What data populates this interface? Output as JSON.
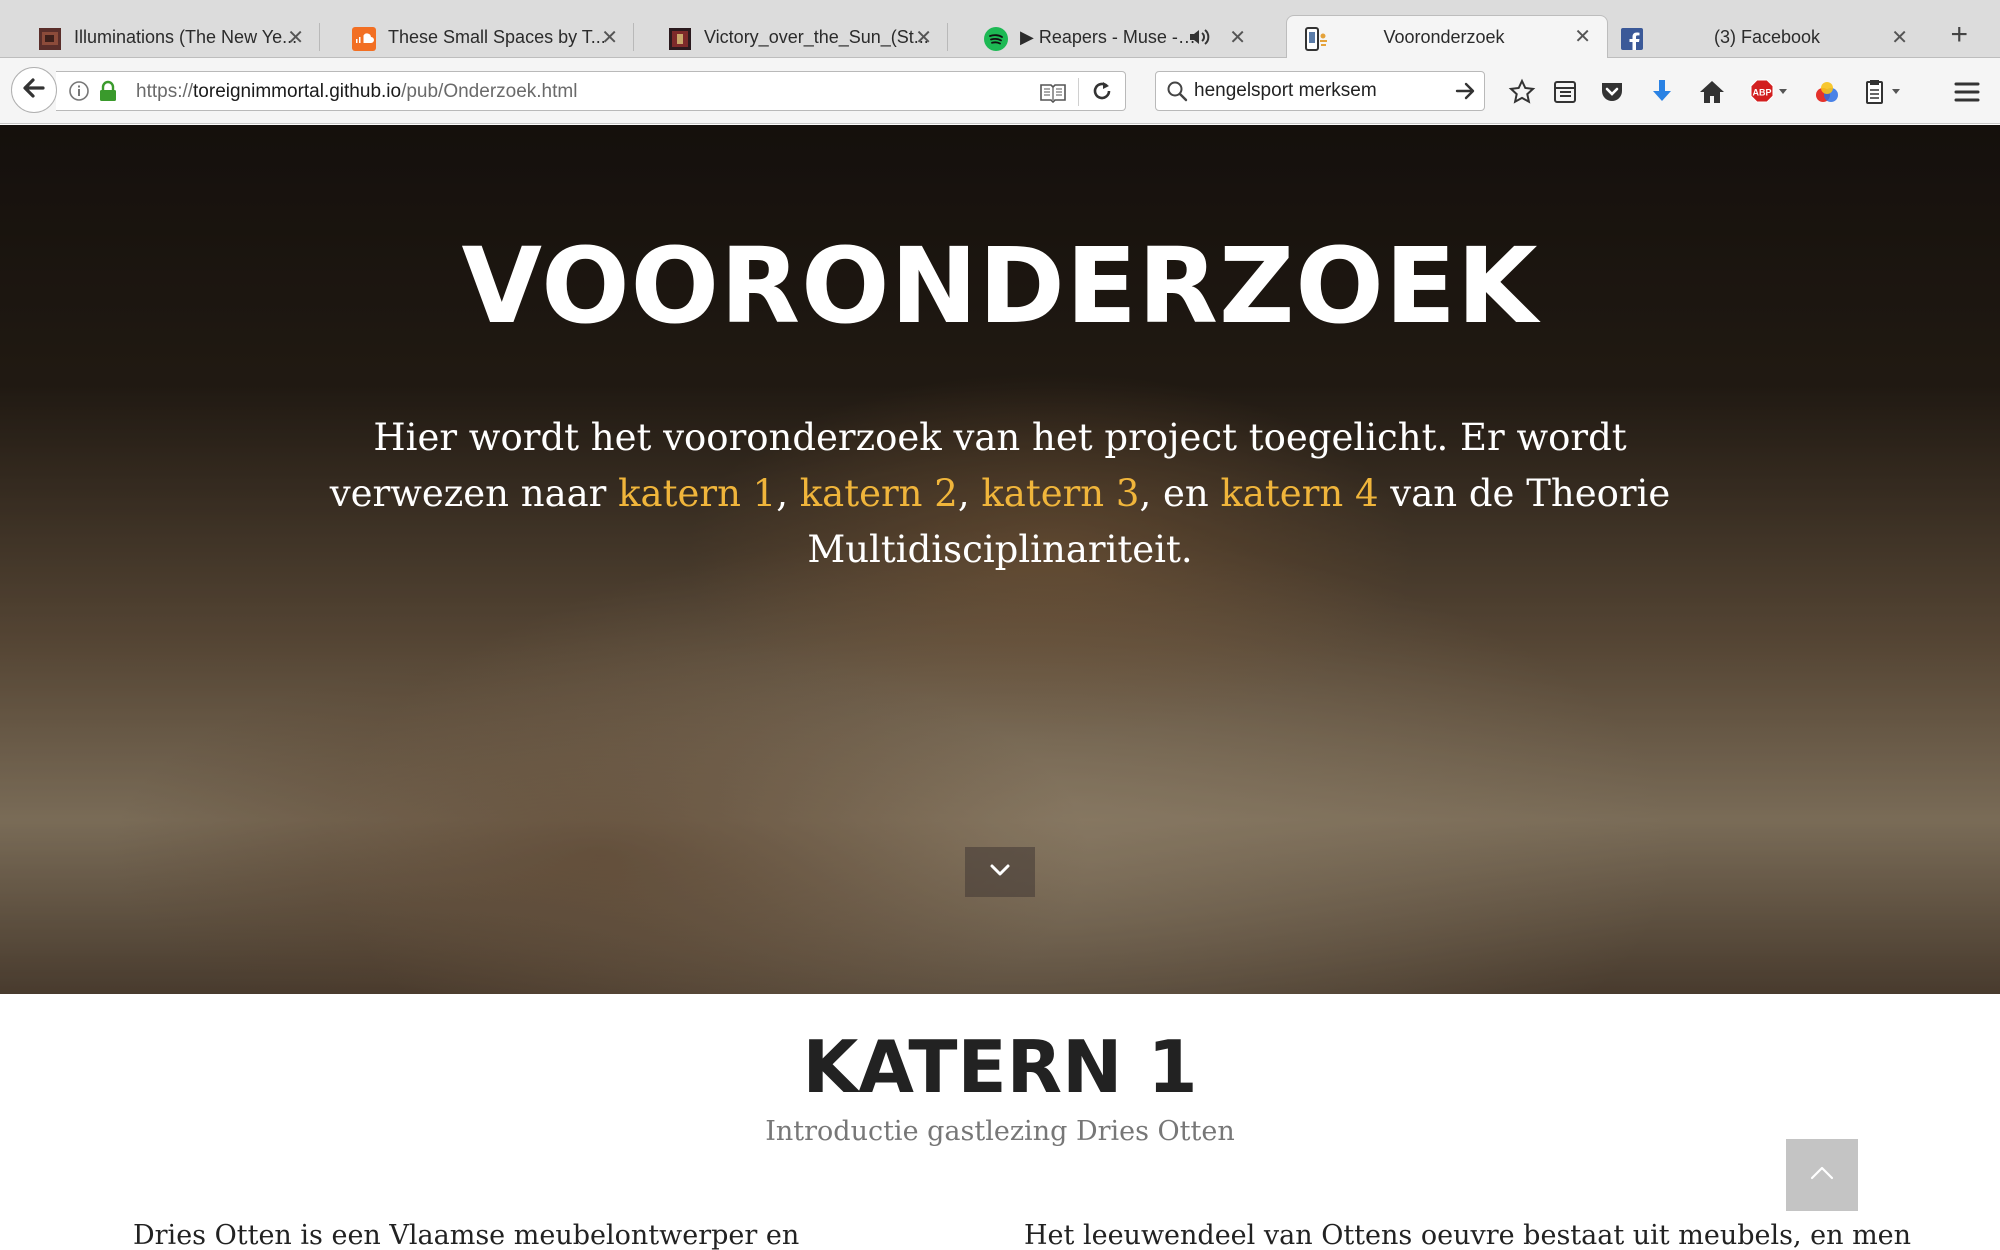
{
  "browser": {
    "tabs": [
      {
        "label": "Illuminations (The New Ye...",
        "icon": "artwork-favicon-icon",
        "active": false
      },
      {
        "label": "These Small Spaces by T...",
        "icon": "soundcloud-icon",
        "active": false
      },
      {
        "label": "Victory_over_the_Sun_(St...",
        "icon": "artwork-favicon-icon",
        "active": false
      },
      {
        "label": "▶ Reapers - Muse - S...",
        "icon": "spotify-icon",
        "active": false,
        "audio": true
      },
      {
        "label": "Vooronderzoek",
        "icon": "site-favicon-icon",
        "active": true
      },
      {
        "label": "(3) Facebook",
        "icon": "facebook-icon",
        "active": false
      }
    ],
    "new_tab_label": "+",
    "close_glyph": "✕",
    "url_prefix": "https://",
    "url_host": "toreignimmortal.github.io",
    "url_path": "/pub/Onderzoek.html",
    "search_value": "hengelsport merksem",
    "colors": {
      "secure_lock": "#3a9a2c",
      "download_arrow": "#2a82e4",
      "abp_red": "#d21f1f"
    }
  },
  "hero": {
    "title": "VOORONDERZOEK",
    "lead_before": "Hier wordt het vooronderzoek van het project toegelicht. Er wordt verwezen naar ",
    "links": [
      "katern 1",
      "katern 2",
      "katern 3",
      "katern 4"
    ],
    "sep1": ", ",
    "sep2": ", ",
    "sep3": ", en ",
    "lead_after": " van de Theorie Multidisciplinariteit.",
    "link_color": "#f0b53b"
  },
  "section": {
    "title": "KATERN 1",
    "subtitle": "Introductie gastlezing Dries Otten",
    "col_left": "Dries Otten is een Vlaamse meubelontwerper en",
    "col_right": "Het leeuwendeel van Ottens oeuvre bestaat uit meubels, en men"
  }
}
